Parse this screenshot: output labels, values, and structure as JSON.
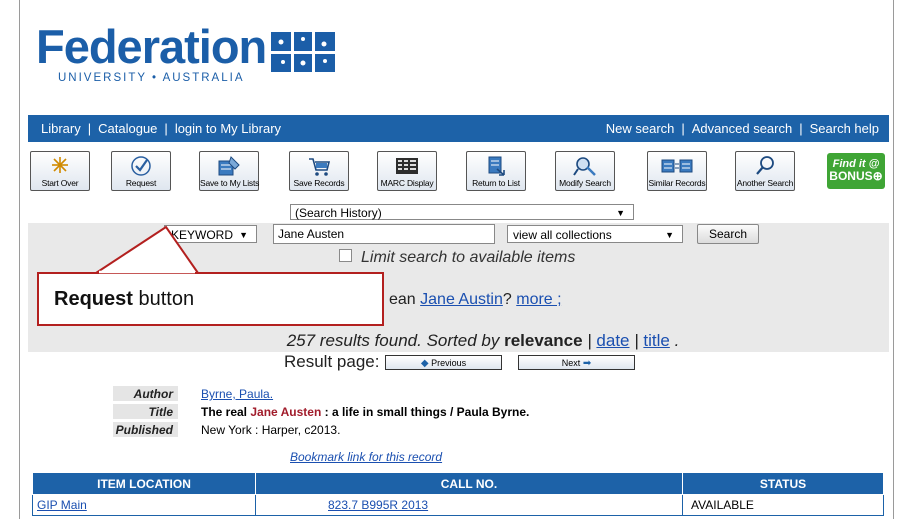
{
  "logo": {
    "word": "Federation",
    "sub": "UNIVERSITY • AUSTRALIA"
  },
  "nav": {
    "left": [
      "Library",
      "Catalogue",
      "login to My Library"
    ],
    "right": [
      "New search",
      "Advanced search",
      "Search help"
    ]
  },
  "toolbar": {
    "buttons": [
      "Start Over",
      "Request",
      "Save to My Lists",
      "Save Records",
      "MARC Display",
      "Return to List",
      "Modify Search",
      "Similar Records",
      "Another Search"
    ],
    "findit_line1": "Find it @",
    "findit_line2": "BONUS"
  },
  "history": {
    "label": "(Search History)"
  },
  "search": {
    "type": "KEYWORD",
    "query": "Jane Austen",
    "collection": "view all collections",
    "button": "Search",
    "limit_label": "Limit search to available items"
  },
  "suggestion": {
    "prefix": "ean ",
    "term": "Jane Austin",
    "suffix": "?",
    "more": "more ;"
  },
  "callout": {
    "bold": "Request",
    "rest": " button"
  },
  "results": {
    "count_text": "257 results found.",
    "sorted_text": " Sorted by ",
    "relevance": "relevance",
    "sep1": " | ",
    "date": "date",
    "sep2": " | ",
    "title": "title",
    "end": " .",
    "page_label": "Result page:",
    "prev": "Previous",
    "next": "Next"
  },
  "record": {
    "author_label": "Author",
    "author": "Byrne, Paula.",
    "title_label": "Title",
    "title_pre": "The real ",
    "title_hl": "Jane Austen",
    "title_post": " : a life in small things / Paula Byrne.",
    "published_label": "Published",
    "published": "New York : Harper, c2013.",
    "bookmark": "Bookmark link for this record"
  },
  "holdings": {
    "headers": [
      "ITEM LOCATION",
      "CALL NO.",
      "STATUS"
    ],
    "rows": [
      [
        "GIP Main",
        "823.7 B995R 2013",
        "AVAILABLE"
      ]
    ]
  },
  "colors": {
    "brand_blue": "#1d62a8",
    "callout_red": "#b3201f",
    "bonus_green": "#3fa535"
  }
}
